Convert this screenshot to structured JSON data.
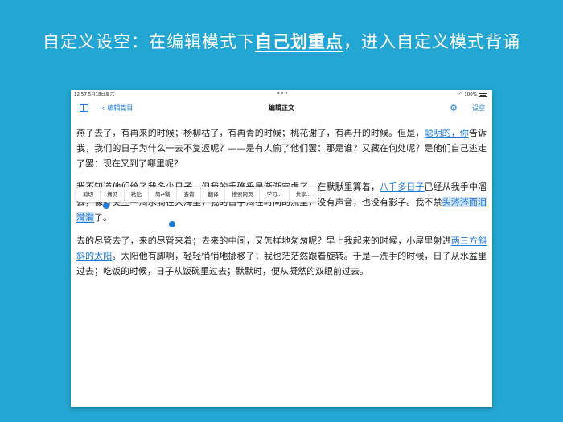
{
  "banner": {
    "prefix": "自定义设空：在编辑模式下",
    "highlight": "自己划重点",
    "suffix": "，进入自定义模式背诵"
  },
  "statusbar": {
    "time": "12:57  5月18日周六",
    "dots": "•••",
    "battery": "100%"
  },
  "navbar": {
    "back_label": "编辑篇目",
    "title": "编辑正文",
    "settings_label": "设空"
  },
  "menu": {
    "items": [
      "剪切",
      "拷贝",
      "粘贴",
      "简⇌繁",
      "查询",
      "翻译",
      "搜索网页",
      "学习...",
      "共享..."
    ]
  },
  "content": {
    "p1_a": "燕子去了，有再来的时候；杨柳枯了，有再青的时候；桃花谢了，有再开的时候。但是，",
    "p1_link": "聪明的，你",
    "p1_b": "告诉我，我们的日子为什么一去不复返呢？——是有人偷了他们罢：那是谁？又藏在何处呢？是他们自己逃走了罢：现在又到了哪里呢？",
    "p2_a": "我不知道他们给了我多少日子，但我的手确乎是渐渐空虚了。在默默里算着，",
    "p2_link": "八千多日子",
    "p2_b": "已经从我手中溜去，像针尖上一滴水滴在大海里，我的日子滴在时间的流里，没有声音，也没有影子。我不禁",
    "p2_sel": "头涔涔而泪潸潸",
    "p2_c": "了。",
    "p3_a": "去的尽管去了，来的尽管来着；去来的中间，又怎样地匆匆呢？早上我起来的时候，小屋里射进",
    "p3_link": "两三方斜斜的太阳",
    "p3_b": "。太阳他有脚啊，轻轻悄悄地挪移了；我也茫茫然跟着旋转。于是—洗手的时候，日子从水盆里过去；吃饭的时候，日子从饭碗里过去；默默时，便从凝然的双眼前过去。"
  },
  "colors": {
    "background": "#23a6d3",
    "accent": "#1f7ad6",
    "selection": "#cfe3f7"
  }
}
